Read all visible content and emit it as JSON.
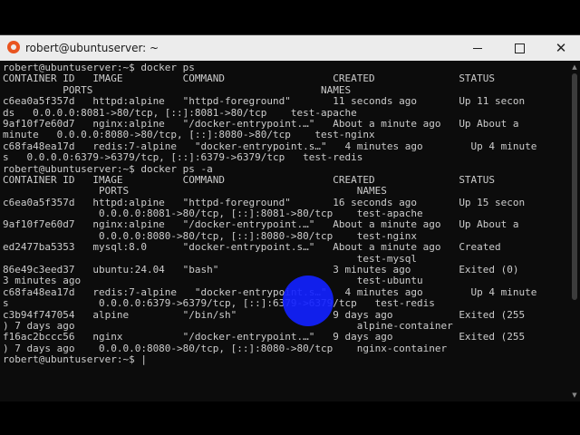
{
  "window": {
    "title": "robert@ubuntuserver: ~",
    "icon": "terminal-penguin-icon",
    "controls": {
      "minimize": "minimize-icon",
      "maximize": "maximize-icon",
      "close": "close-icon",
      "close_glyph": "✕"
    }
  },
  "terminal": {
    "lines": [
      "robert@ubuntuserver:~$ docker ps",
      "CONTAINER ID   IMAGE          COMMAND                  CREATED              STATUS",
      "          PORTS                                      NAMES",
      "c6ea0a5f357d   httpd:alpine   \"httpd-foreground\"       11 seconds ago       Up 11 secon",
      "ds   0.0.0.0:8081->80/tcp, [::]:8081->80/tcp    test-apache",
      "9af10f7e60d7   nginx:alpine   \"/docker-entrypoint.…\"   About a minute ago   Up About a",
      "minute   0.0.0.0:8080->80/tcp, [::]:8080->80/tcp    test-nginx",
      "c68fa48ea17d   redis:7-alpine   \"docker-entrypoint.s…\"   4 minutes ago        Up 4 minute",
      "s   0.0.0.0:6379->6379/tcp, [::]:6379->6379/tcp   test-redis",
      "robert@ubuntuserver:~$ docker ps -a",
      "CONTAINER ID   IMAGE          COMMAND                  CREATED              STATUS",
      "                PORTS                                      NAMES",
      "c6ea0a5f357d   httpd:alpine   \"httpd-foreground\"       16 seconds ago       Up 15 secon",
      "                0.0.0.0:8081->80/tcp, [::]:8081->80/tcp    test-apache",
      "9af10f7e60d7   nginx:alpine   \"/docker-entrypoint.…\"   About a minute ago   Up About a",
      "                0.0.0.0:8080->80/tcp, [::]:8080->80/tcp    test-nginx",
      "ed2477ba5353   mysql:8.0      \"docker-entrypoint.s…\"   About a minute ago   Created",
      "                                                           test-mysql",
      "86e49c3eed37   ubuntu:24.04   \"bash\"                   3 minutes ago        Exited (0)",
      "3 minutes ago                                              test-ubuntu",
      "c68fa48ea17d   redis:7-alpine   \"docker-entrypoint.s…\"   4 minutes ago        Up 4 minute",
      "s               0.0.0.0:6379->6379/tcp, [::]:6379->6379/tcp   test-redis",
      "c3b94f747054   alpine         \"/bin/sh\"                9 days ago           Exited (255",
      ") 7 days ago                                               alpine-container",
      "f16ac2bccc56   nginx          \"/docker-entrypoint.…\"   9 days ago           Exited (255",
      ") 7 days ago    0.0.0.0:8080->80/tcp, [::]:8080->80/tcp    nginx-container",
      "robert@ubuntuserver:~$ |"
    ]
  }
}
